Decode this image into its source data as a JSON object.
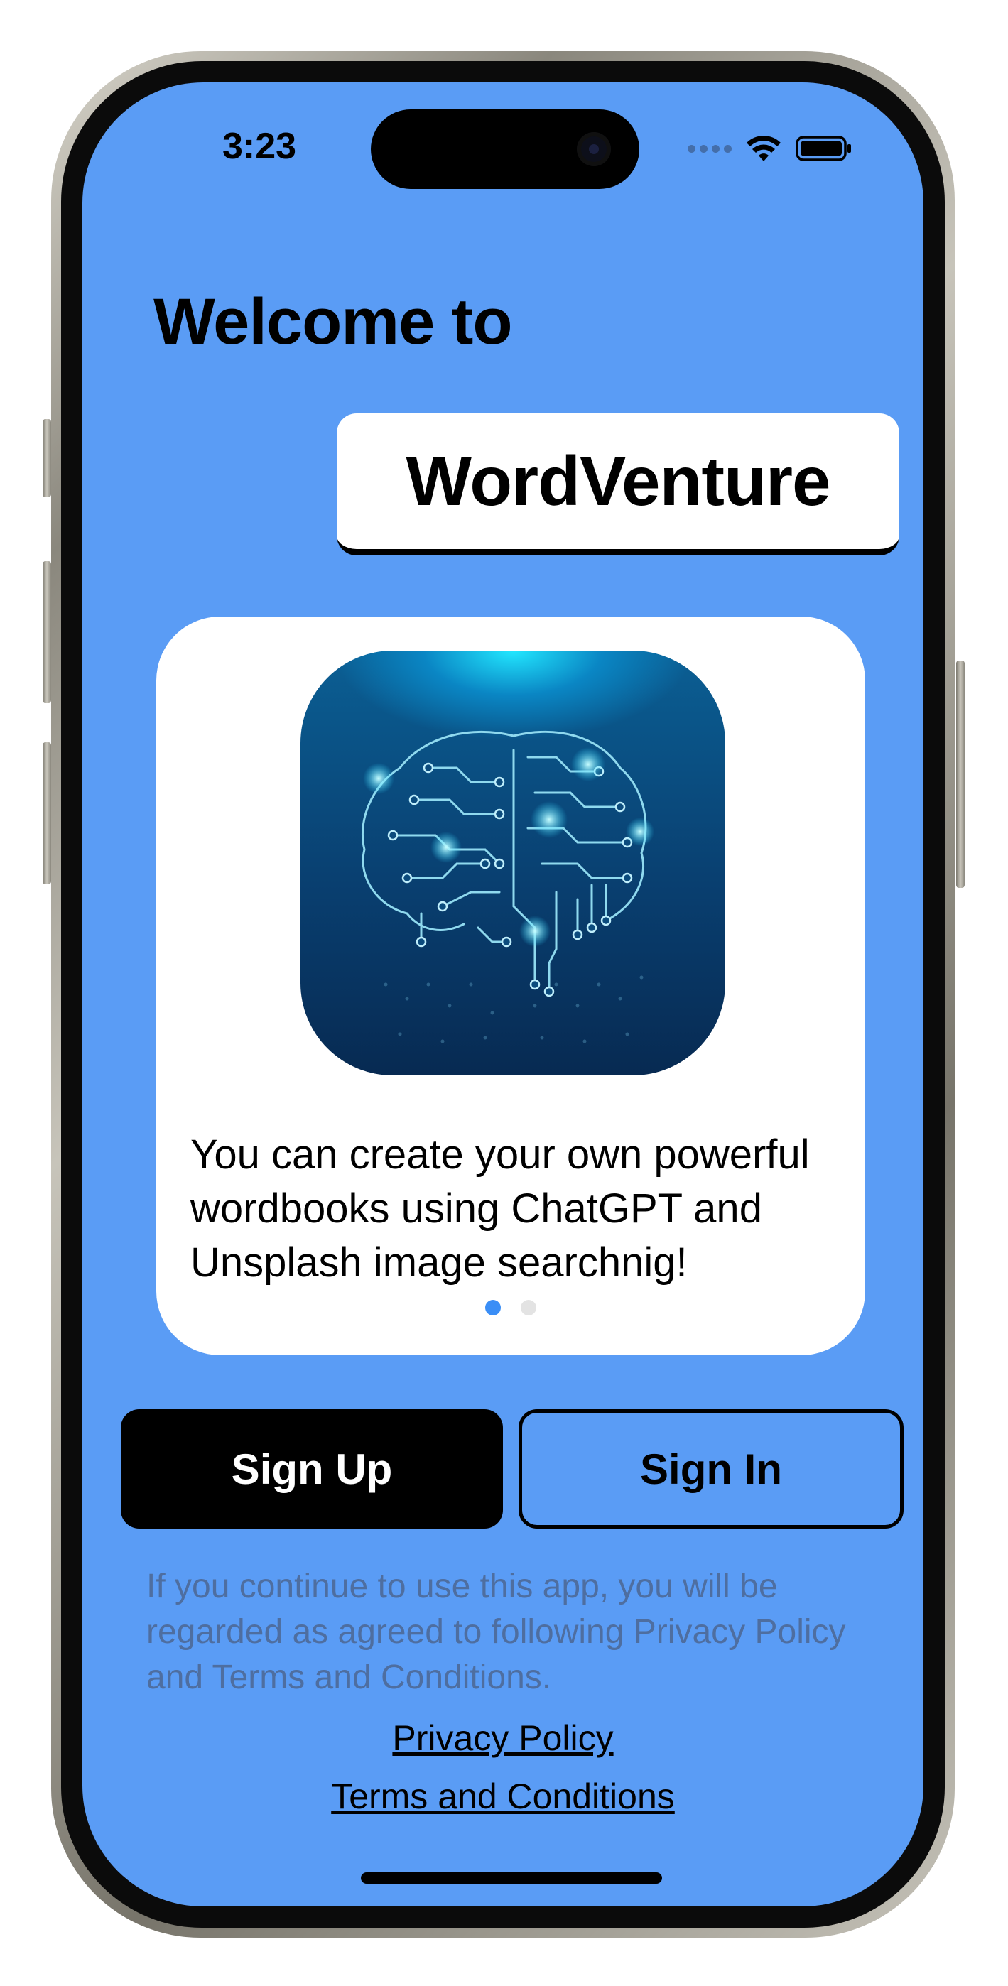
{
  "status_bar": {
    "time": "3:23",
    "icons": [
      "signal-dots-icon",
      "wifi-icon",
      "battery-icon"
    ]
  },
  "welcome": {
    "heading": "Welcome to",
    "app_name": "WordVenture"
  },
  "onboarding_card": {
    "image": "ai-brain-circuit-illustration",
    "description": "You can create your own powerful wordbooks using ChatGPT and Unsplash image searchnig!",
    "page_index": 0,
    "page_count": 2
  },
  "actions": {
    "sign_up_label": "Sign Up",
    "sign_in_label": "Sign In"
  },
  "legal": {
    "notice": "If you continue to use this app, you will be regarded as agreed to following Privacy Policy and Terms and Conditions.",
    "privacy_policy_link": "Privacy Policy",
    "terms_link": "Terms and Conditions"
  },
  "colors": {
    "background": "#5a9cf5",
    "card": "#ffffff",
    "primary_button": "#000000",
    "page_dot_active": "#3a8ef6",
    "page_dot_inactive": "#e3e3e3",
    "notice_text": "#4e6ea0"
  }
}
